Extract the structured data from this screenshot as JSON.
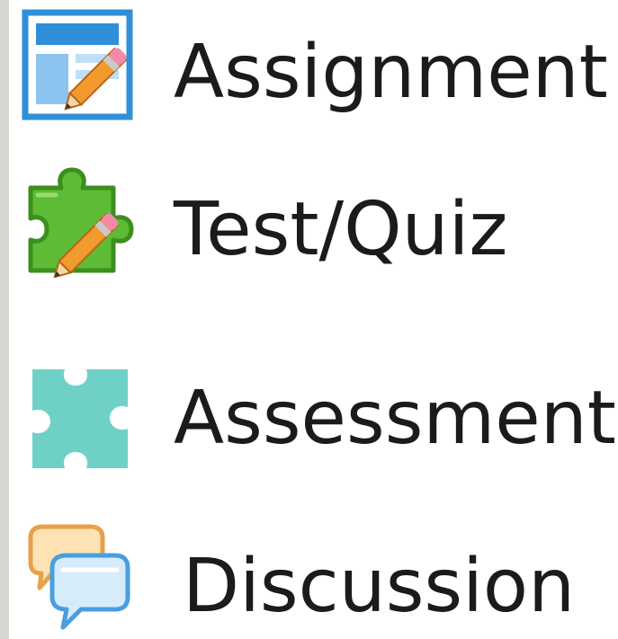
{
  "menu": {
    "items": [
      {
        "label": "Assignment",
        "icon": "assignment-icon"
      },
      {
        "label": "Test/Quiz",
        "icon": "test-quiz-icon"
      },
      {
        "label": "Assessment",
        "icon": "assessment-icon"
      },
      {
        "label": "Discussion",
        "icon": "discussion-icon"
      }
    ]
  },
  "colors": {
    "text": "#1b1b1b",
    "assignment_blue": "#2f8fd8",
    "test_green": "#5dbb35",
    "assessment_teal": "#6fd1c6",
    "discussion_orange": "#f0b060",
    "discussion_blue": "#4a9ee0",
    "pencil_orange": "#f29a2e",
    "left_edge": "#d7d5d1"
  }
}
